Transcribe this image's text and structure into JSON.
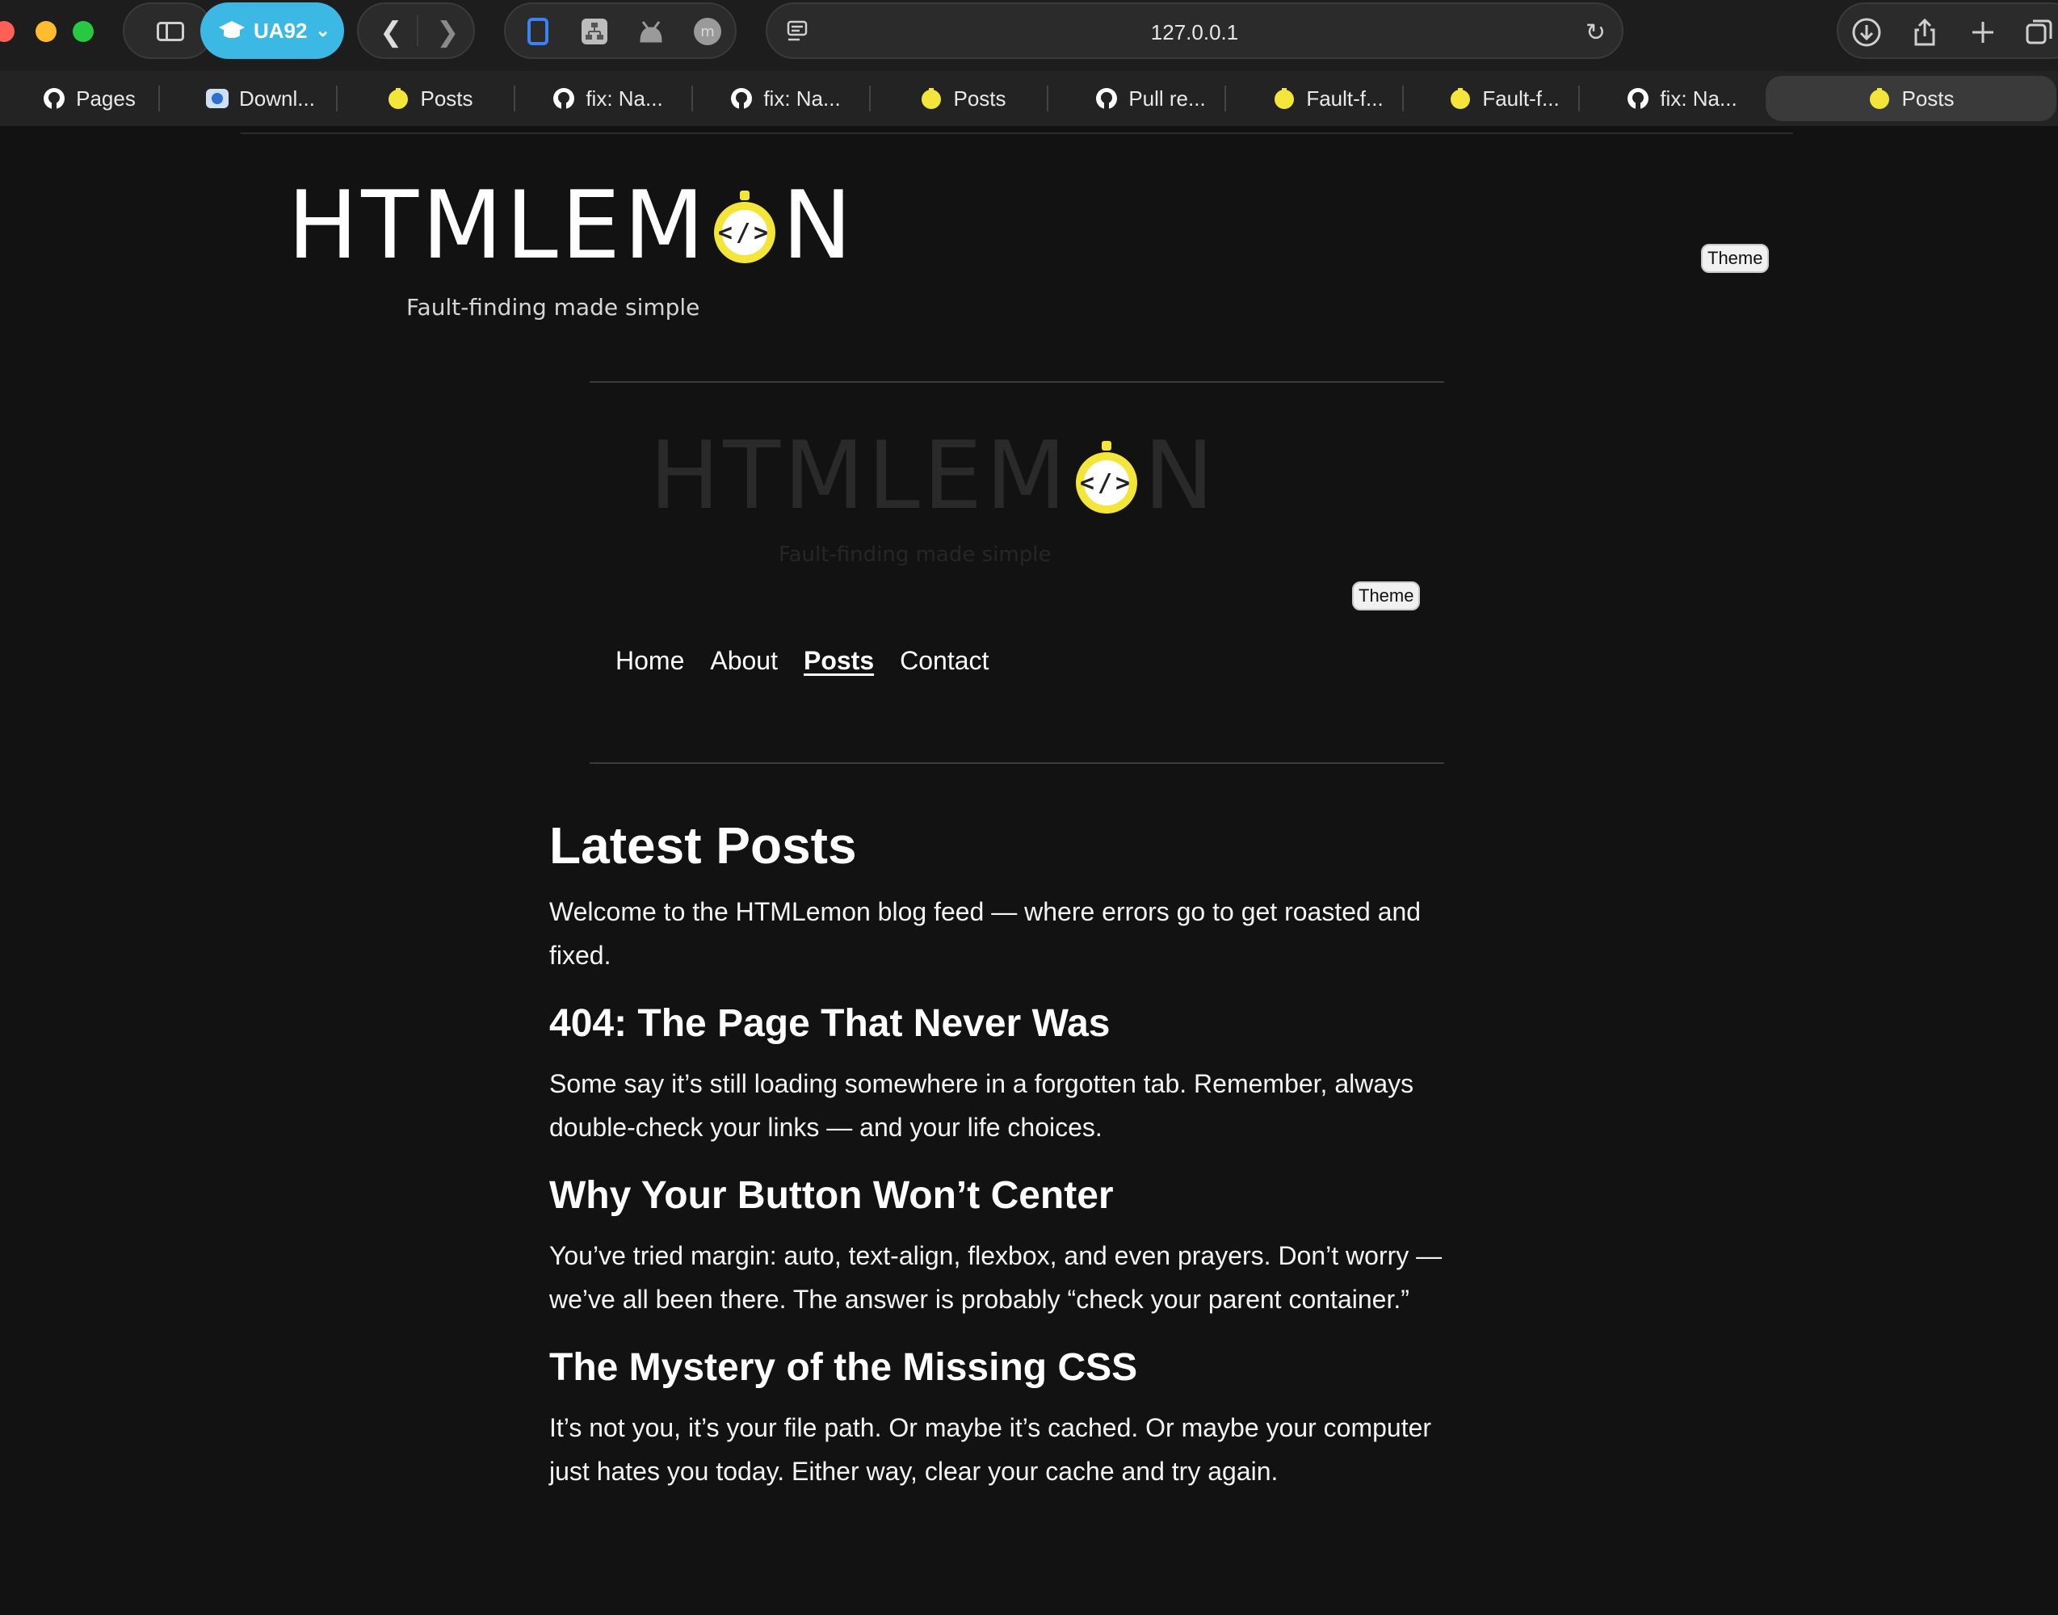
{
  "browser": {
    "profile": "UA92",
    "url": "127.0.0.1",
    "tabs": [
      {
        "label": "Pages",
        "icon": "github-icon"
      },
      {
        "label": "Downl...",
        "icon": "download-site-icon"
      },
      {
        "label": "Posts",
        "icon": "htmlemon-icon"
      },
      {
        "label": "fix: Na...",
        "icon": "github-icon"
      },
      {
        "label": "fix: Na...",
        "icon": "github-icon"
      },
      {
        "label": "Posts",
        "icon": "htmlemon-icon"
      },
      {
        "label": "Pull re...",
        "icon": "github-icon"
      },
      {
        "label": "Fault-f...",
        "icon": "htmlemon-icon"
      },
      {
        "label": "Fault-f...",
        "icon": "htmlemon-icon"
      },
      {
        "label": "fix: Na...",
        "icon": "github-icon"
      },
      {
        "label": "Posts",
        "icon": "htmlemon-icon"
      }
    ]
  },
  "site": {
    "logo_left": "HTMLEM",
    "logo_right": "N",
    "logo_badge": "</>",
    "tagline": "Fault-finding made simple",
    "theme_label": "Theme",
    "nav": [
      "Home",
      "About",
      "Posts",
      "Contact"
    ],
    "current_nav": "Posts"
  },
  "main": {
    "title": "Latest Posts",
    "intro": "Welcome to the HTMLemon blog feed — where errors go to get roasted and fixed.",
    "posts": [
      {
        "title": "404: The Page That Never Was",
        "body": "Some say it’s still loading somewhere in a forgotten tab. Remember, always double-check your links — and your life choices."
      },
      {
        "title": "Why Your Button Won’t Center",
        "body": "You’ve tried margin: auto, text-align, flexbox, and even prayers. Don’t worry — we’ve all been there. The answer is probably “check your parent container.”"
      },
      {
        "title": "The Mystery of the Missing CSS",
        "body": "It’s not you, it’s your file path. Or maybe it’s cached. Or maybe your computer just hates you today. Either way, clear your cache and try again."
      }
    ]
  },
  "colors": {
    "background": "#121212",
    "lemon": "#f4e53a",
    "profile_accent": "#3cb8e4"
  }
}
